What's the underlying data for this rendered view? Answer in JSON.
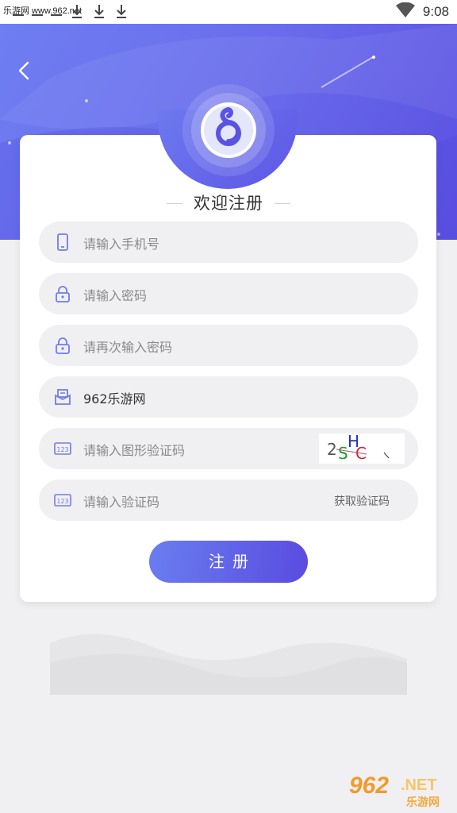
{
  "status_bar": {
    "watermark": "乐游网 www.962.net",
    "time": "9:08"
  },
  "header": {
    "back_icon": "chevron-left-icon"
  },
  "card": {
    "title": "欢迎注册",
    "fields": {
      "phone": {
        "icon": "phone-icon",
        "placeholder": "请输入手机号"
      },
      "password": {
        "icon": "lock-icon",
        "placeholder": "请输入密码"
      },
      "confirm_password": {
        "icon": "lock-icon",
        "placeholder": "请再次输入密码"
      },
      "invite": {
        "icon": "mail-icon",
        "value": "962乐游网"
      },
      "image_code": {
        "icon": "code-123-icon",
        "placeholder": "请输入图形验证码",
        "captcha": [
          "2",
          "S",
          "H",
          "C"
        ]
      },
      "sms_code": {
        "icon": "code-123-icon",
        "placeholder": "请输入验证码",
        "get_code_label": "获取验证码"
      }
    },
    "submit_label": "注册"
  },
  "watermark_logo": {
    "number": "962",
    "suffix": ".NET",
    "cn": "乐游网"
  },
  "colors": {
    "primary": "#5e5ae6",
    "primary_light": "#6f7ef2",
    "background": "#f0f0f2"
  }
}
